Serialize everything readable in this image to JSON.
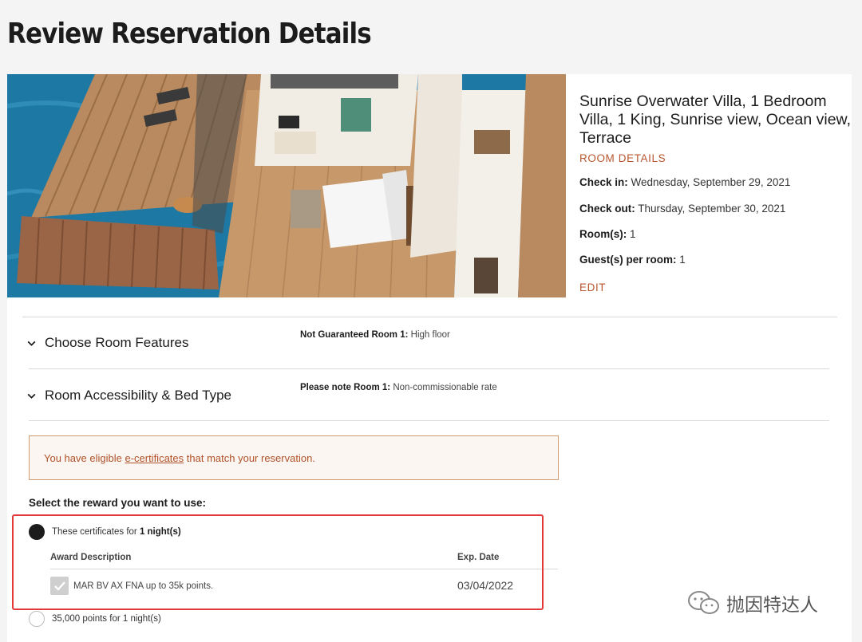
{
  "page": {
    "title": "Review Reservation Details"
  },
  "room": {
    "title": "Sunrise Overwater Villa, 1 Bedroom Villa, 1 King, Sunrise view, Ocean view, Terrace",
    "details_link": "ROOM DETAILS",
    "check_in_label": "Check in:",
    "check_in_value": "Wednesday, September 29, 2021",
    "check_out_label": "Check out:",
    "check_out_value": "Thursday, September 30, 2021",
    "rooms_label": "Room(s):",
    "rooms_value": "1",
    "guests_label": "Guest(s) per room:",
    "guests_value": "1",
    "edit_link": "EDIT"
  },
  "sections": [
    {
      "label": "Choose Room Features",
      "note_label": "Not Guaranteed Room 1:",
      "note_value": "High floor"
    },
    {
      "label": "Room Accessibility & Bed Type",
      "note_label": "Please note Room 1:",
      "note_value": "Non-commissionable rate"
    }
  ],
  "alert": {
    "prefix": "You have eligible ",
    "link": "e-certificates",
    "suffix": " that match your reservation."
  },
  "rewards": {
    "prompt": "Select the reward you want to use:",
    "option1_prefix": "These certificates for ",
    "option1_bold": "1 night(s)",
    "col_award": "Award Description",
    "col_exp": "Exp. Date",
    "award_desc": "MAR BV AX FNA up to 35k points.",
    "exp_date": "03/04/2022",
    "option2": "35,000 points for 1 night(s)"
  },
  "watermark": {
    "text": "抛因特达人"
  },
  "colors": {
    "accent": "#b8552e",
    "highlight": "#e23a3a",
    "alert_bg": "#fbf6f1"
  }
}
